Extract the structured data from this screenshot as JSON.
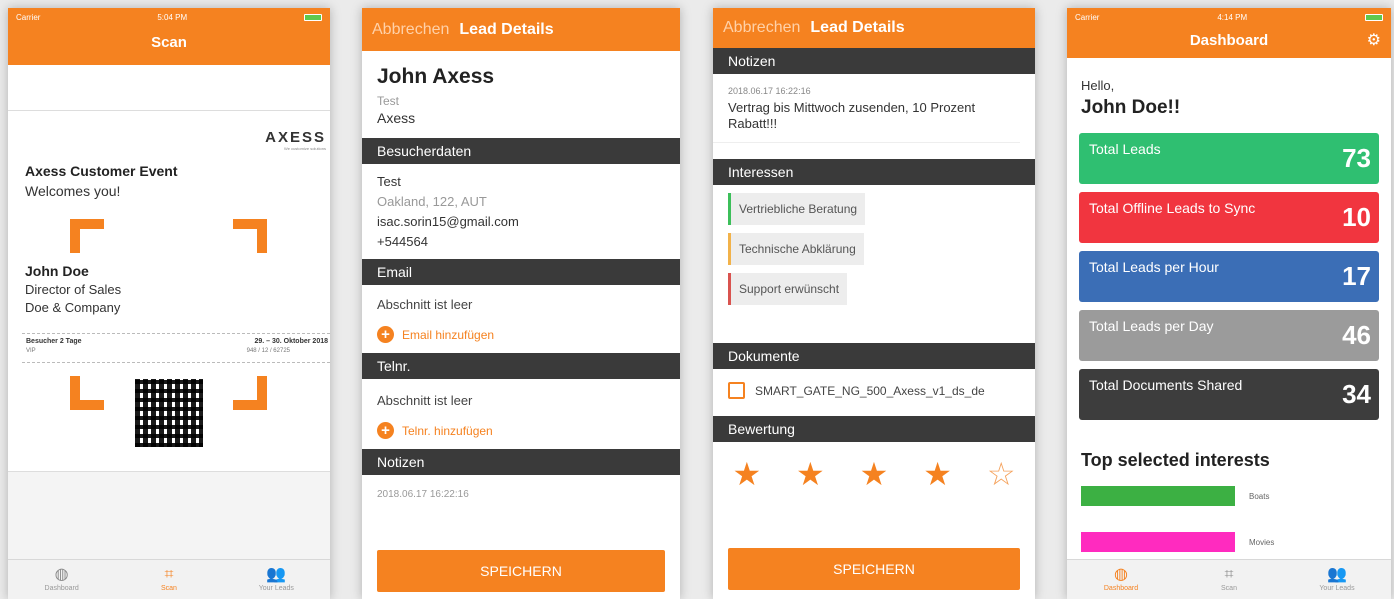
{
  "colors": {
    "accent": "#f58220",
    "section_bar": "#3a3a3a",
    "stat_green": "#2fbf71",
    "stat_red": "#f1353f",
    "stat_blue": "#3b6eb6",
    "stat_gray": "#9b9b9b",
    "stat_dark": "#3d3d3d"
  },
  "scan": {
    "status_carrier": "Carrier",
    "status_time": "5:04 PM",
    "title": "Scan",
    "ticket": {
      "logo": "AXESS",
      "logo_sub": "We customize solutions",
      "event_title": "Axess Customer Event",
      "event_sub": "Welcomes you!",
      "person_name": "John Doe",
      "person_title": "Director of Sales",
      "company": "Doe & Company",
      "visitor_label": "Besucher 2 Tage",
      "visitor_type": "VIP",
      "date": "29. – 30. Oktober 2018",
      "code": "948 / 12 / 62725"
    },
    "tabs": [
      {
        "icon": "dashboard-icon",
        "glyph": "◍",
        "label": "Dashboard"
      },
      {
        "icon": "scan-icon",
        "glyph": "⌗",
        "label": "Scan",
        "active": true
      },
      {
        "icon": "leads-icon",
        "glyph": "👥",
        "label": "Your Leads"
      }
    ]
  },
  "lead": {
    "cancel": "Abbrechen",
    "title": "Lead Details",
    "name": "John Axess",
    "subtitle": "Test",
    "company": "Axess",
    "sections": {
      "visitor": "Besucherdaten",
      "email": "Email",
      "phone": "Telnr.",
      "notes": "Notizen"
    },
    "visitor": {
      "name": "Test",
      "address": "Oakland, 122, AUT",
      "email": "isac.sorin15@gmail.com",
      "phone": "+544564"
    },
    "email_empty": "Abschnitt ist leer",
    "email_add": "Email hinzufügen",
    "phone_empty": "Abschnitt ist leer",
    "phone_add": "Telnr. hinzufügen",
    "note_time": "2018.06.17 16:22:16",
    "save": "SPEICHERN"
  },
  "lead2": {
    "cancel": "Abbrechen",
    "title": "Lead Details",
    "sections": {
      "notes": "Notizen",
      "interests": "Interessen",
      "documents": "Dokumente",
      "rating": "Bewertung"
    },
    "note_time": "2018.06.17 16:22:16",
    "note_text": "Vertrag bis Mittwoch zusenden, 10 Prozent Rabatt!!!",
    "interests": [
      {
        "label": "Vertriebliche Beratung",
        "color": "#3cbf5a"
      },
      {
        "label": "Technische Abklärung",
        "color": "#f2b24a"
      },
      {
        "label": "Support erwünscht",
        "color": "#d9534f"
      }
    ],
    "document": "SMART_GATE_NG_500_Axess_v1_ds_de",
    "rating_value": 4,
    "rating_max": 5,
    "save": "SPEICHERN"
  },
  "dashboard": {
    "status_carrier": "Carrier",
    "status_time": "4:14 PM",
    "title": "Dashboard",
    "hello": "Hello,",
    "user": "John Doe!!",
    "stats": [
      {
        "label": "Total Leads",
        "value": "73",
        "color": "#2fbf71"
      },
      {
        "label": "Total Offline Leads to Sync",
        "value": "10",
        "color": "#f1353f"
      },
      {
        "label": "Total Leads per Hour",
        "value": "17",
        "color": "#3b6eb6"
      },
      {
        "label": "Total Leads per Day",
        "value": "46",
        "color": "#9b9b9b"
      },
      {
        "label": "Total Documents Shared",
        "value": "34",
        "color": "#3d3d3d"
      }
    ],
    "interests_title": "Top selected interests",
    "interests": [
      {
        "label": "Boats",
        "color": "#3cb043",
        "share": 0.55
      },
      {
        "label": "Movies",
        "color": "#ff2bbf",
        "share": 0.55
      }
    ],
    "tabs": [
      {
        "icon": "dashboard-icon",
        "glyph": "◍",
        "label": "Dashboard",
        "active": true
      },
      {
        "icon": "scan-icon",
        "glyph": "⌗",
        "label": "Scan"
      },
      {
        "icon": "leads-icon",
        "glyph": "👥",
        "label": "Your Leads"
      }
    ]
  }
}
